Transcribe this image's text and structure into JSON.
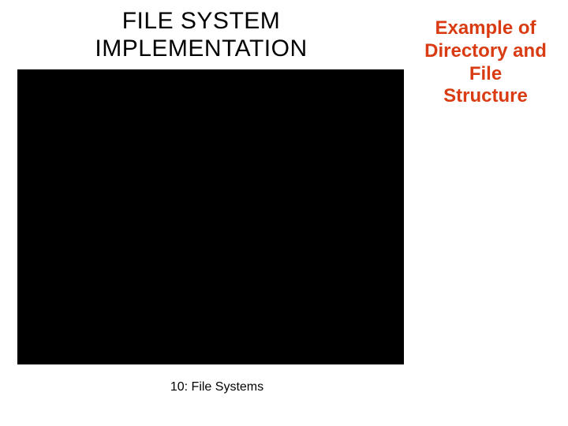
{
  "slide": {
    "title_left": "FILE SYSTEM IMPLEMENTATION",
    "title_right_l1": "Example of",
    "title_right_l2": "Directory and",
    "title_right_l3": "File",
    "title_right_l4": "Structure",
    "footer": "10: File Systems"
  },
  "colors": {
    "accent": "#d93b12",
    "figure_bg": "#000000",
    "slide_bg": "#ffffff"
  }
}
